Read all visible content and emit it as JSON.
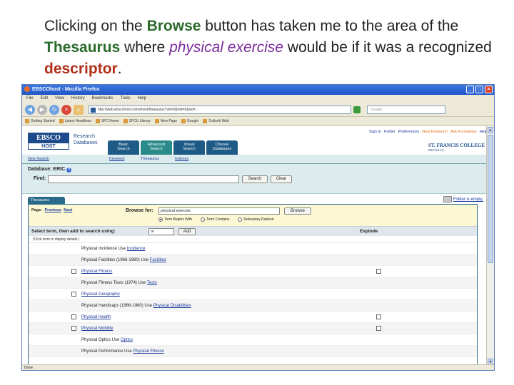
{
  "caption": {
    "part1": "Clicking on the ",
    "browse": "Browse",
    "part2": " button has taken me to the area of the ",
    "thesaurus": "Thesaurus",
    "part3": " where ",
    "physical_exercise": "physical exercise",
    "part4": " would be if it was a recognized ",
    "descriptor": "descriptor",
    "part5": "."
  },
  "browser": {
    "title": "EBSCOhost - Mozilla Firefox",
    "menu": [
      "File",
      "Edit",
      "View",
      "History",
      "Bookmarks",
      "Tools",
      "Help"
    ],
    "url": "http://web.ebscohost.com/ehost/thesaurus?vid=3&hid=6&sid=...",
    "search_placeholder": "Google",
    "bookmarks": [
      "Getting Started",
      "Latest Headlines",
      "SFC Home",
      "SFCU Library",
      "New Page",
      "Google",
      "Outlook Web"
    ],
    "status": "Done"
  },
  "ebsco": {
    "logo_top": "EBSCO",
    "logo_bottom": "HOST",
    "research_databases": [
      "Research",
      "Databases"
    ],
    "tabs": [
      {
        "line1": "Basic",
        "line2": "Search"
      },
      {
        "line1": "Advanced",
        "line2": "Search"
      },
      {
        "line1": "Visual",
        "line2": "Search"
      },
      {
        "line1": "Choose",
        "line2": "Databases"
      }
    ],
    "top_links": [
      "Sign In",
      "Folder",
      "Preferences",
      "New Features!",
      "Ask A Librarian",
      "Help"
    ],
    "institution": "ST. FRANCIS COLLEGE",
    "institution_sub": "BROOKLYN",
    "subnav": {
      "new_search": "New Search",
      "keyword": "Keyword",
      "thesaurus": "Thesaurus",
      "indexes": "Indexes"
    },
    "database_label": "Database: ERIC",
    "find_label": "Find:",
    "search_button": "Search",
    "clear_button": "Clear",
    "thesaurus_tab": "Thesaurus",
    "folder_empty": "Folder is empty.",
    "page_label": "Page:",
    "previous": "Previous",
    "next": "Next",
    "browse_for_label": "Browse for:",
    "browse_value": "physical exercise",
    "browse_button": "Browse",
    "radio_options": [
      "Term Begins With",
      "Term Contains",
      "Relevancy Ranked"
    ],
    "select_label": "Select term, then add to search using:",
    "or_option": "or",
    "add_button": "Add",
    "explode_label": "Explode",
    "hint": "(Click term to display details.)"
  },
  "terms": [
    {
      "checkbox": false,
      "explode": false,
      "text": "Physical Incidence Use ",
      "link": "Incidence"
    },
    {
      "checkbox": false,
      "explode": false,
      "text": "Physical Facilities (1966-1980) Use ",
      "link": "Facilities"
    },
    {
      "checkbox": true,
      "explode": true,
      "text": "",
      "link": "Physical Fitness"
    },
    {
      "checkbox": false,
      "explode": false,
      "text": "Physical Fitness Tests (1974) Use ",
      "link": "Tests"
    },
    {
      "checkbox": true,
      "explode": false,
      "text": "",
      "link": "Physical Geography"
    },
    {
      "checkbox": false,
      "explode": false,
      "text": "Physical Handicaps (1966-1980) Use ",
      "link": "Physical Disabilities"
    },
    {
      "checkbox": true,
      "explode": true,
      "text": "",
      "link": "Physical Health"
    },
    {
      "checkbox": true,
      "explode": true,
      "text": "",
      "link": "Physical Mobility"
    },
    {
      "checkbox": false,
      "explode": false,
      "text": "Physical Optics Use ",
      "link": "Optics"
    },
    {
      "checkbox": false,
      "explode": false,
      "text": "Physical Performance Use ",
      "link": "Physical Fitness"
    }
  ]
}
